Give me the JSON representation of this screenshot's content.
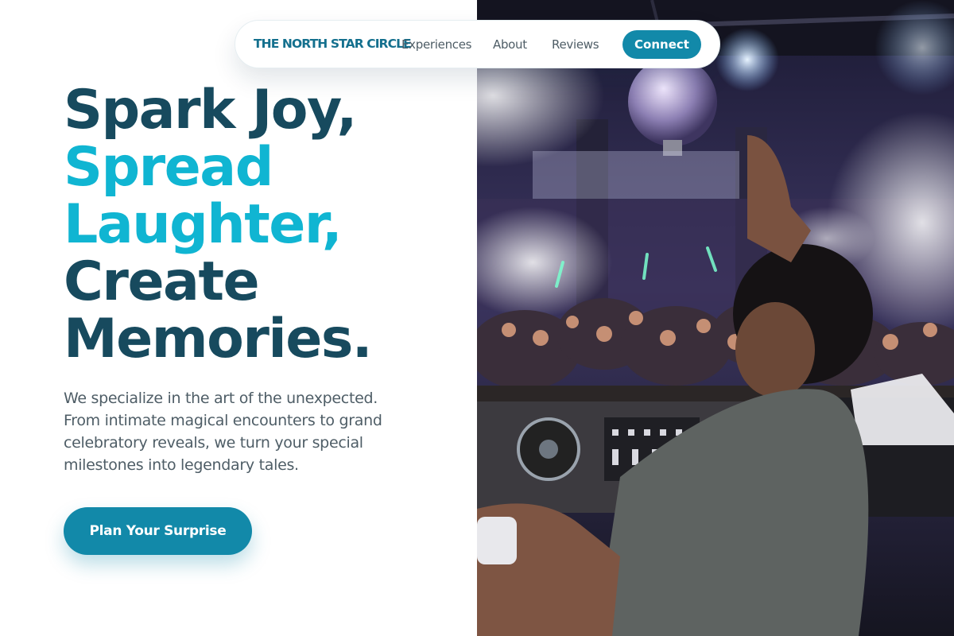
{
  "nav": {
    "brand": "THE NORTH STAR CIRCLE",
    "links": [
      "Experiences",
      "About",
      "Reviews"
    ],
    "cta_label": "Connect"
  },
  "hero": {
    "title_lines": [
      "Spark Joy,",
      "Spread",
      "Laughter,",
      "Create",
      "Memories."
    ],
    "description": "We specialize in the art of the unexpected. From intimate magical encounters to grand celebratory reveals, we turn your special milestones into legendary tales.",
    "cta_label": "Plan Your Surprise"
  },
  "photo": {
    "subject": "dj-performing-at-crowded-nightclub-photo"
  },
  "colors": {
    "primary": "#1289a9",
    "heading_dark": "#174a5e",
    "heading_accent": "#10b5d2",
    "body_text": "#4e5d66",
    "brand_text": "#14708e"
  }
}
